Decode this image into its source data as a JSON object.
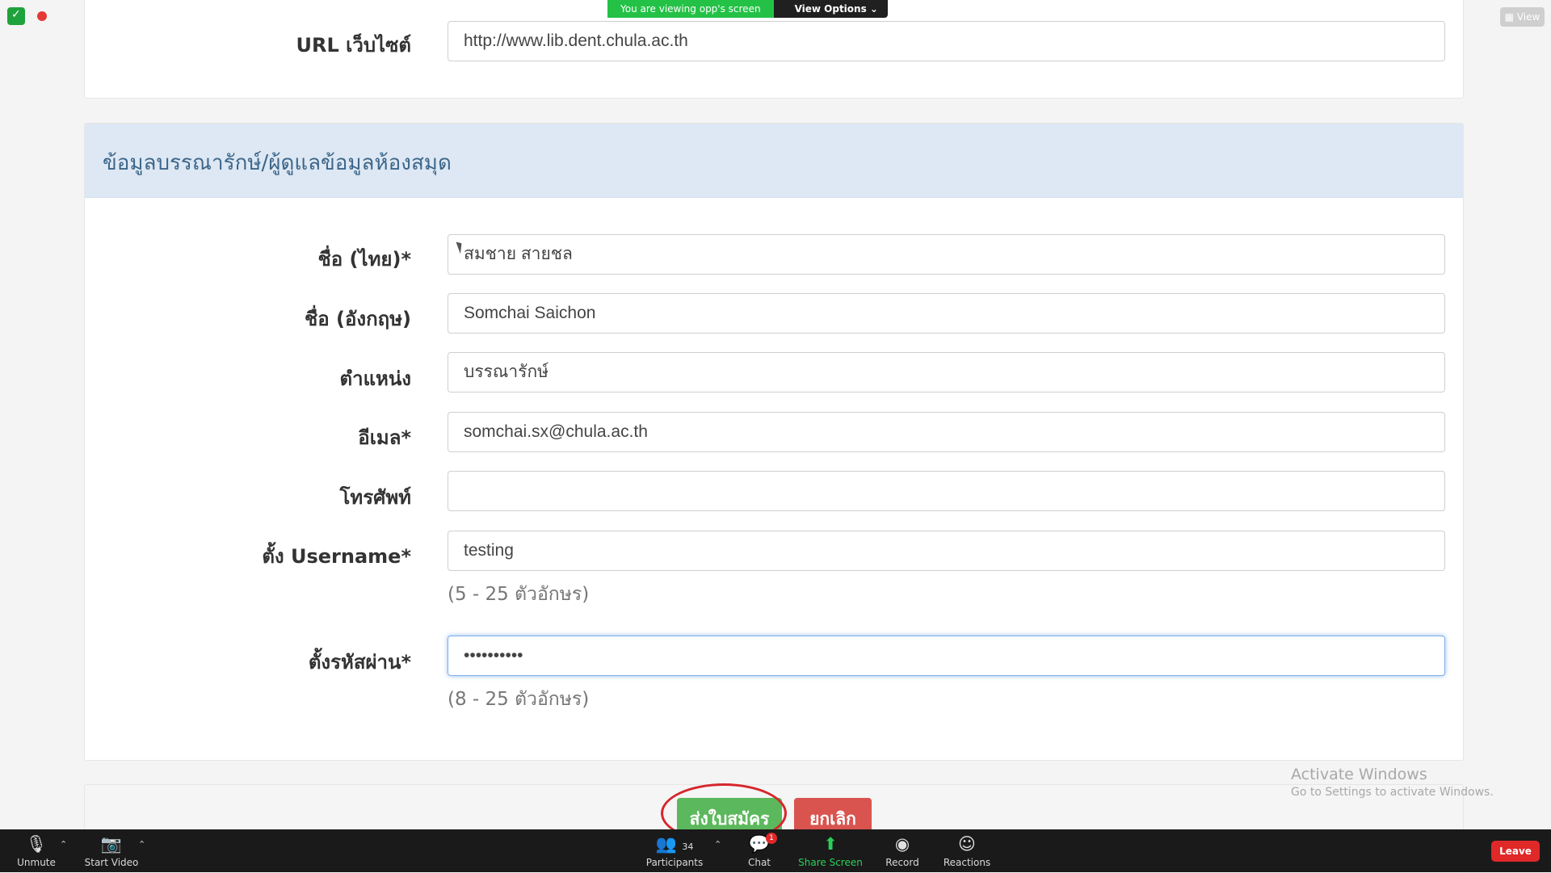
{
  "share_banner": {
    "viewing_text": "You are viewing opp's screen",
    "view_options": "View Options ⌄"
  },
  "view_button": "▦ View",
  "top_section": {
    "website_label": "URL เว็บไซต์",
    "website_value": "http://www.lib.dent.chula.ac.th"
  },
  "librarian_section": {
    "heading": "ข้อมูลบรรณารักษ์/ผู้ดูแลข้อมูลห้องสมุด",
    "fields": [
      {
        "label": "ชื่อ (ไทย)*",
        "value": "สมชาย สายชล"
      },
      {
        "label": "ชื่อ (อังกฤษ)",
        "value": "Somchai Saichon"
      },
      {
        "label": "ตำแหน่ง",
        "value": "บรรณารักษ์"
      },
      {
        "label": "อีเมล*",
        "value": "somchai.sx@chula.ac.th"
      },
      {
        "label": "โทรศัพท์",
        "value": ""
      },
      {
        "label": "ตั้ง Username*",
        "value": "testing"
      },
      {
        "label": "ตั้งรหัสผ่าน*",
        "value": "••••••••••"
      }
    ],
    "username_hint": "(5 - 25 ตัวอักษร)",
    "password_hint": "(8 - 25 ตัวอักษร)"
  },
  "actions": {
    "submit": "ส่งใบสมัคร",
    "cancel": "ยกเลิก"
  },
  "watermark": {
    "title": "Activate Windows",
    "subtitle": "Go to Settings to activate Windows."
  },
  "toolbar": {
    "unmute": "Unmute",
    "start_video": "Start Video",
    "participants": "Participants",
    "participants_count": "34",
    "chat": "Chat",
    "chat_badge": "1",
    "share_screen": "Share Screen",
    "record": "Record",
    "reactions": "Reactions",
    "leave": "Leave"
  },
  "colors": {
    "submit": "#5cb85c",
    "cancel": "#d9534f",
    "heading_bg": "#dde8f4",
    "share_green": "#23c246",
    "leave": "#e02828"
  }
}
